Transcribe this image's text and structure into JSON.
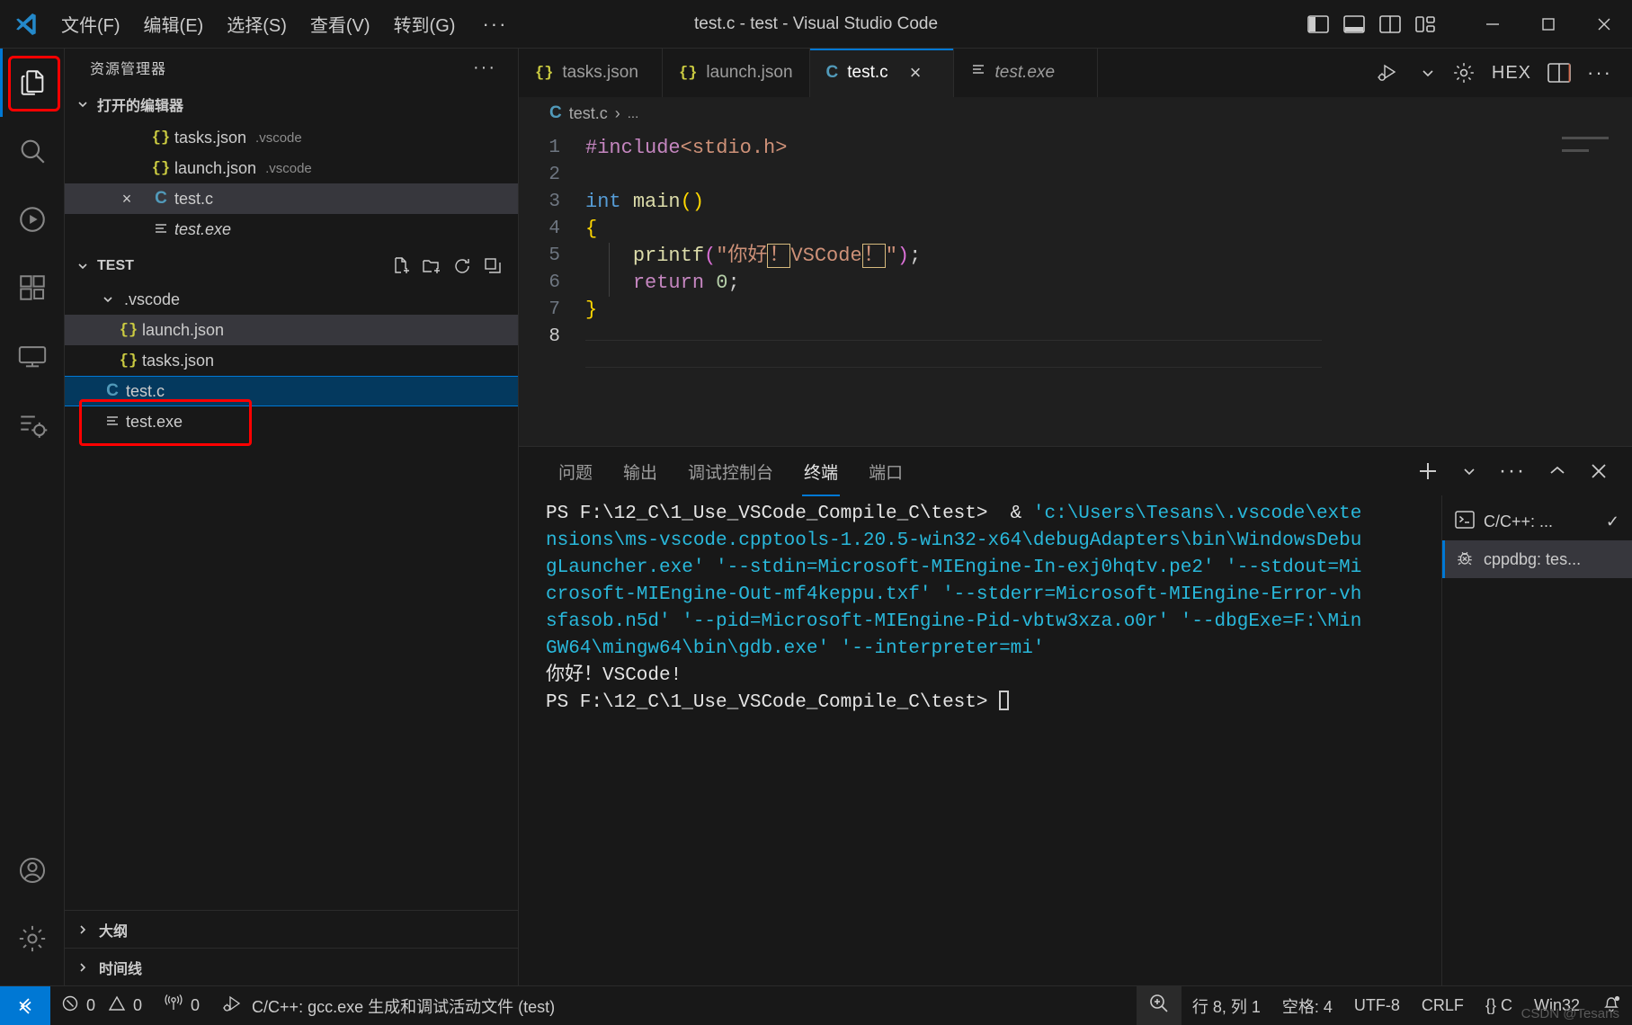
{
  "titlebar": {
    "logo_icon": "vscode-logo-icon",
    "menus": [
      "文件(F)",
      "编辑(E)",
      "选择(S)",
      "查看(V)",
      "转到(G)"
    ],
    "more_label": "···",
    "window_title": "test.c - test - Visual Studio Code",
    "layout_controls": [
      "toggle-primary-sidebar-icon",
      "toggle-panel-icon",
      "toggle-secondary-sidebar-icon",
      "customize-layout-icon"
    ],
    "window_controls": [
      "minimize-icon",
      "maximize-icon",
      "close-icon"
    ]
  },
  "activitybar": {
    "items": [
      {
        "name": "explorer",
        "icon": "files-icon",
        "active": true
      },
      {
        "name": "search",
        "icon": "search-icon",
        "active": false
      },
      {
        "name": "run-and-debug",
        "icon": "run-debug-icon",
        "active": false
      },
      {
        "name": "extensions",
        "icon": "extensions-icon",
        "active": false
      },
      {
        "name": "remote-explorer",
        "icon": "remote-explorer-icon",
        "active": false
      },
      {
        "name": "testing",
        "icon": "testing-icon",
        "active": false
      }
    ],
    "bottom_items": [
      {
        "name": "accounts",
        "icon": "account-icon"
      },
      {
        "name": "manage",
        "icon": "gear-icon"
      }
    ]
  },
  "sidebar": {
    "title": "资源管理器",
    "more_label": "···",
    "open_editors": {
      "header": "打开的编辑器",
      "items": [
        {
          "icon": "json-icon",
          "label": "tasks.json",
          "desc": ".vscode",
          "state": "normal",
          "italic": false
        },
        {
          "icon": "json-icon",
          "label": "launch.json",
          "desc": ".vscode",
          "state": "normal",
          "italic": false
        },
        {
          "icon": "c-icon",
          "label": "test.c",
          "desc": "",
          "state": "selected",
          "italic": false,
          "close": "×"
        },
        {
          "icon": "binary-icon",
          "label": "test.exe",
          "desc": "",
          "state": "normal",
          "italic": true
        }
      ]
    },
    "workspace": {
      "header": "TEST",
      "actions": [
        "new-file-icon",
        "new-folder-icon",
        "refresh-icon",
        "collapse-all-icon"
      ],
      "items": [
        {
          "icon": "folder-open-icon",
          "label": ".vscode",
          "depth": 1,
          "state": "normal",
          "italic": false
        },
        {
          "icon": "json-icon",
          "label": "launch.json",
          "depth": 2,
          "state": "hover",
          "italic": false
        },
        {
          "icon": "json-icon",
          "label": "tasks.json",
          "depth": 2,
          "state": "normal",
          "italic": false
        },
        {
          "icon": "c-icon",
          "label": "test.c",
          "depth": 1,
          "state": "active",
          "italic": false
        },
        {
          "icon": "binary-icon",
          "label": "test.exe",
          "depth": 1,
          "state": "normal",
          "italic": false
        }
      ]
    },
    "footer_sections": [
      {
        "label": "大纲",
        "icon": "chevron-right-icon"
      },
      {
        "label": "时间线",
        "icon": "chevron-right-icon"
      }
    ],
    "highlight_color": "#ff0000"
  },
  "editor": {
    "tabs": [
      {
        "icon": "json-icon",
        "label": "tasks.json",
        "active": false,
        "italic": false
      },
      {
        "icon": "json-icon",
        "label": "launch.json",
        "active": false,
        "italic": false
      },
      {
        "icon": "c-icon",
        "label": "test.c",
        "active": true,
        "italic": false,
        "close": "×"
      },
      {
        "icon": "binary-icon",
        "label": "test.exe",
        "active": false,
        "italic": true
      }
    ],
    "tab_actions": [
      "run-and-debug-icon",
      "chevron-down-icon",
      "settings-gear-icon",
      "hex-editor-icon",
      "split-editor-icon",
      "more-actions-icon"
    ],
    "hex_label": "HEX",
    "breadcrumb": {
      "icon": "c-icon",
      "file": "test.c",
      "separator": "›",
      "tail": "..."
    },
    "lines": [
      {
        "num": "1",
        "tokens": [
          {
            "t": "#include",
            "c": "k-inc"
          },
          {
            "t": "<stdio.h>",
            "c": "k-hdr"
          }
        ]
      },
      {
        "num": "2",
        "tokens": []
      },
      {
        "num": "3",
        "tokens": [
          {
            "t": "int",
            "c": "k-type"
          },
          {
            "t": " ",
            "c": "k-plain"
          },
          {
            "t": "main",
            "c": "k-fn"
          },
          {
            "t": "()",
            "c": "k-paren-y"
          }
        ]
      },
      {
        "num": "4",
        "tokens": [
          {
            "t": "{",
            "c": "k-paren-y"
          }
        ]
      },
      {
        "num": "5",
        "tokens": [
          {
            "t": "    ",
            "c": "k-plain"
          },
          {
            "t": "printf",
            "c": "k-fn"
          },
          {
            "t": "(",
            "c": "k-paren-p"
          },
          {
            "t": "\"你好",
            "c": "k-str"
          },
          {
            "t": "！",
            "c": "k-str",
            "box": true
          },
          {
            "t": "VSCode",
            "c": "k-str"
          },
          {
            "t": "！",
            "c": "k-str",
            "box": true
          },
          {
            "t": "\"",
            "c": "k-str"
          },
          {
            "t": ")",
            "c": "k-paren-p"
          },
          {
            "t": ";",
            "c": "k-plain"
          }
        ]
      },
      {
        "num": "6",
        "tokens": [
          {
            "t": "    ",
            "c": "k-plain"
          },
          {
            "t": "return",
            "c": "k-kw"
          },
          {
            "t": " ",
            "c": "k-plain"
          },
          {
            "t": "0",
            "c": "k-num"
          },
          {
            "t": ";",
            "c": "k-plain"
          }
        ]
      },
      {
        "num": "7",
        "tokens": [
          {
            "t": "}",
            "c": "k-paren-y"
          }
        ]
      },
      {
        "num": "8",
        "tokens": [],
        "current": true
      }
    ]
  },
  "panel": {
    "tabs": [
      {
        "label": "问题",
        "active": false
      },
      {
        "label": "输出",
        "active": false
      },
      {
        "label": "调试控制台",
        "active": false
      },
      {
        "label": "终端",
        "active": true
      },
      {
        "label": "端口",
        "active": false
      }
    ],
    "actions": [
      "new-terminal-icon",
      "chevron-down-icon",
      "more-actions-icon",
      "maximize-panel-icon",
      "close-panel-icon"
    ],
    "terminal_lines": [
      {
        "segs": [
          {
            "t": "PS F:\\12_C\\1_Use_VSCode_Compile_C\\test>  & ",
            "c": "t-white"
          },
          {
            "t": "'c:\\Users\\Tesans\\.vscode\\exte",
            "c": "t-cyan"
          }
        ]
      },
      {
        "segs": [
          {
            "t": "nsions\\ms-vscode.cpptools-1.20.5-win32-x64\\debugAdapters\\bin\\WindowsDebu",
            "c": "t-cyan"
          }
        ]
      },
      {
        "segs": [
          {
            "t": "gLauncher.exe' '--stdin=Microsoft-MIEngine-In-exj0hqtv.pe2' '--stdout=Mi",
            "c": "t-cyan"
          }
        ]
      },
      {
        "segs": [
          {
            "t": "crosoft-MIEngine-Out-mf4keppu.txf' '--stderr=Microsoft-MIEngine-Error-vh",
            "c": "t-cyan"
          }
        ]
      },
      {
        "segs": [
          {
            "t": "sfasob.n5d' '--pid=Microsoft-MIEngine-Pid-vbtw3xza.o0r' '--dbgExe=F:\\Min",
            "c": "t-cyan"
          }
        ]
      },
      {
        "segs": [
          {
            "t": "GW64\\mingw64\\bin\\gdb.exe' '--interpreter=mi'",
            "c": "t-cyan"
          }
        ]
      },
      {
        "segs": [
          {
            "t": "你好！VSCode!",
            "c": "t-white"
          }
        ]
      },
      {
        "segs": [
          {
            "t": "PS F:\\12_C\\1_Use_VSCode_Compile_C\\test> ",
            "c": "t-white"
          }
        ],
        "cursor": true
      }
    ],
    "terminal_list": [
      {
        "icon": "terminal-icon",
        "label": "C/C++: ...",
        "active": false,
        "check": "✓"
      },
      {
        "icon": "bug-icon",
        "label": "cppdbg: tes...",
        "active": true,
        "check": ""
      }
    ]
  },
  "statusbar": {
    "remote_icon": "remote-window-icon",
    "left_items": [
      {
        "icon": "error-icon",
        "label": "0",
        "icon2": "warning-icon",
        "label2": "0",
        "name": "problems"
      },
      {
        "icon": "radio-tower-icon",
        "label": "0",
        "name": "ports"
      },
      {
        "icon": "run-debug-task-icon",
        "label": "C/C++: gcc.exe 生成和调试活动文件 (test)",
        "name": "build-task"
      }
    ],
    "right_items": [
      {
        "label": "",
        "icon": "screencast-zoom-icon",
        "name": "zoom-indicator"
      },
      {
        "label": "行 8, 列 1",
        "name": "cursor-position"
      },
      {
        "label": "空格: 4",
        "name": "indentation"
      },
      {
        "label": "UTF-8",
        "name": "encoding"
      },
      {
        "label": "CRLF",
        "name": "eol"
      },
      {
        "label": "{} C",
        "name": "language-mode"
      },
      {
        "label": "Win32",
        "name": "platform"
      },
      {
        "label": "",
        "icon": "bell-icon",
        "name": "notifications"
      }
    ],
    "watermark": "CSDN @Tesans"
  },
  "colors": {
    "accent": "#0078d4",
    "bg": "#1f1f1f",
    "bg_dark": "#181818",
    "selection_blue": "#04395e",
    "selection_grey": "#37373d",
    "highlight_red": "#ff0000",
    "terminal_cyan": "#29b8db",
    "string_orange": "#ce9178"
  }
}
